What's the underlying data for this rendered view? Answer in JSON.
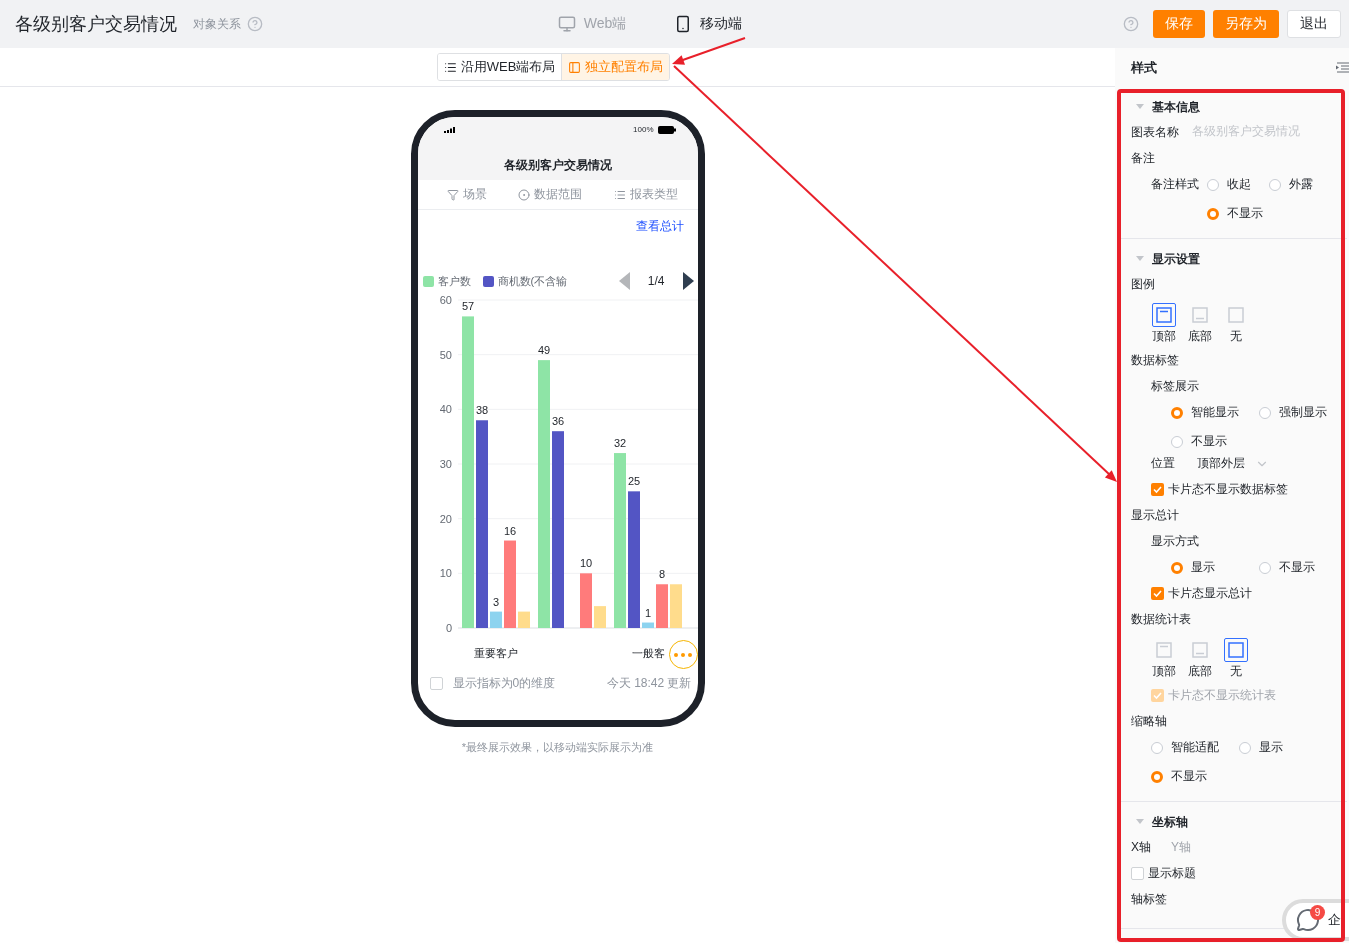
{
  "header": {
    "title": "各级别客户交易情况",
    "link": "对象关系",
    "views": [
      {
        "label": "Web端",
        "kind": "desktop",
        "selected": false
      },
      {
        "label": "移动端",
        "kind": "mobile",
        "selected": true
      }
    ],
    "buttons": [
      {
        "label": "保存",
        "kind": "primary"
      },
      {
        "label": "另存为",
        "kind": "primary"
      },
      {
        "label": "退出",
        "kind": "default"
      }
    ]
  },
  "layout_switch": [
    {
      "label": "沿用WEB端布局",
      "kind": "list",
      "selected": false
    },
    {
      "label": "独立配置布局",
      "kind": "panel",
      "selected": true
    }
  ],
  "phone": {
    "battery": "100%",
    "title": "各级别客户交易情况",
    "filters": [
      {
        "label": "场景",
        "kind": "filter"
      },
      {
        "label": "数据范围",
        "kind": "scope"
      },
      {
        "label": "报表类型",
        "kind": "list"
      }
    ],
    "total_link": "查看总计",
    "legend_pager": {
      "page": "1/4",
      "prev_disabled": true,
      "next_disabled": false
    },
    "chart_data": {
      "type": "bar",
      "categories": [
        "重要客户",
        null,
        "一般客"
      ],
      "ylim": [
        0,
        60
      ],
      "grid": true,
      "yticks": [
        0,
        10,
        20,
        30,
        40,
        50,
        60
      ],
      "series": [
        {
          "name": "客户数",
          "color": "#8ee4a6",
          "values": [
            57,
            49,
            32
          ]
        },
        {
          "name": "商机数(不含输",
          "color": "#5355c4",
          "values": [
            38,
            36,
            25
          ]
        },
        {
          "color": "#8dd3ef",
          "values": [
            3,
            null,
            1
          ]
        },
        {
          "color": "#ff7b7b",
          "values": [
            16,
            10,
            8
          ]
        },
        {
          "color": "#ffdc8c",
          "values": [
            3,
            4,
            8
          ]
        }
      ],
      "value_labels": [
        [
          "57",
          "49",
          "32"
        ],
        [
          "38",
          "36",
          "25"
        ],
        [
          "3",
          null,
          "1"
        ],
        [
          "16",
          "10",
          "8"
        ],
        [
          null,
          null,
          null
        ]
      ]
    },
    "show_zero": {
      "label": "显示指标为0的维度",
      "checked": false
    },
    "updated": "今天 18:42 更新"
  },
  "note": "*最终展示效果，以移动端实际展示为准",
  "panel": {
    "title": "样式",
    "sections": [
      {
        "title": "基本信息",
        "expanded": true,
        "rows": [
          {
            "kind": "field",
            "label": "图表名称",
            "placeholder": "各级别客户交易情况"
          },
          {
            "kind": "heading",
            "label": "备注",
            "children": [
              {
                "kind": "radio",
                "label": "备注样式",
                "options": [
                  {
                    "label": "收起",
                    "selected": false
                  },
                  {
                    "label": "外露",
                    "selected": false
                  },
                  {
                    "label": "不显示",
                    "selected": true
                  }
                ]
              }
            ]
          }
        ]
      },
      {
        "title": "显示设置",
        "expanded": true,
        "rows": [
          {
            "kind": "heading",
            "label": "图例",
            "children": [
              {
                "kind": "picker",
                "options": [
                  {
                    "label": "顶部",
                    "kind": "top",
                    "selected": true
                  },
                  {
                    "label": "底部",
                    "kind": "bottom",
                    "selected": false
                  },
                  {
                    "label": "无",
                    "kind": "none",
                    "selected": false
                  }
                ]
              }
            ]
          },
          {
            "kind": "heading",
            "label": "数据标签",
            "children": [
              {
                "kind": "heading",
                "label": "标签展示",
                "children": [
                  {
                    "kind": "radio",
                    "options": [
                      {
                        "label": "智能显示",
                        "selected": true
                      },
                      {
                        "label": "强制显示",
                        "selected": false
                      },
                      {
                        "label": "不显示",
                        "selected": false
                      }
                    ]
                  }
                ]
              },
              {
                "kind": "select",
                "label": "位置",
                "value": "顶部外层"
              },
              {
                "kind": "checkbox",
                "label": "卡片态不显示数据标签",
                "checked": true,
                "disabled": false
              }
            ]
          },
          {
            "kind": "heading",
            "label": "显示总计",
            "children": [
              {
                "kind": "heading",
                "label": "显示方式",
                "children": [
                  {
                    "kind": "radio",
                    "options": [
                      {
                        "label": "显示",
                        "selected": true
                      },
                      {
                        "label": "不显示",
                        "selected": false
                      }
                    ]
                  }
                ]
              },
              {
                "kind": "checkbox",
                "label": "卡片态显示总计",
                "checked": true,
                "disabled": false
              }
            ]
          },
          {
            "kind": "heading",
            "label": "数据统计表",
            "children": [
              {
                "kind": "picker",
                "options": [
                  {
                    "label": "顶部",
                    "kind": "top",
                    "selected": false
                  },
                  {
                    "label": "底部",
                    "kind": "bottom",
                    "selected": false
                  },
                  {
                    "label": "无",
                    "kind": "none",
                    "selected": true
                  }
                ]
              },
              {
                "kind": "checkbox",
                "label": "卡片态不显示统计表",
                "checked": true,
                "disabled": true
              }
            ]
          },
          {
            "kind": "heading",
            "label": "缩略轴",
            "children": [
              {
                "kind": "radio",
                "options": [
                  {
                    "label": "智能适配",
                    "selected": false
                  },
                  {
                    "label": "显示",
                    "selected": false
                  },
                  {
                    "label": "不显示",
                    "selected": true
                  }
                ]
              }
            ]
          }
        ]
      },
      {
        "title": "坐标轴",
        "expanded": true,
        "rows": [
          {
            "kind": "tabs",
            "options": [
              {
                "label": "X轴",
                "selected": true
              },
              {
                "label": "Y轴",
                "selected": false
              }
            ]
          },
          {
            "kind": "checkbox",
            "label": "显示标题",
            "checked": false,
            "disabled": false
          },
          {
            "kind": "heading",
            "label": "轴标签"
          }
        ]
      }
    ]
  },
  "chat": {
    "badge": "9",
    "label": "企"
  }
}
